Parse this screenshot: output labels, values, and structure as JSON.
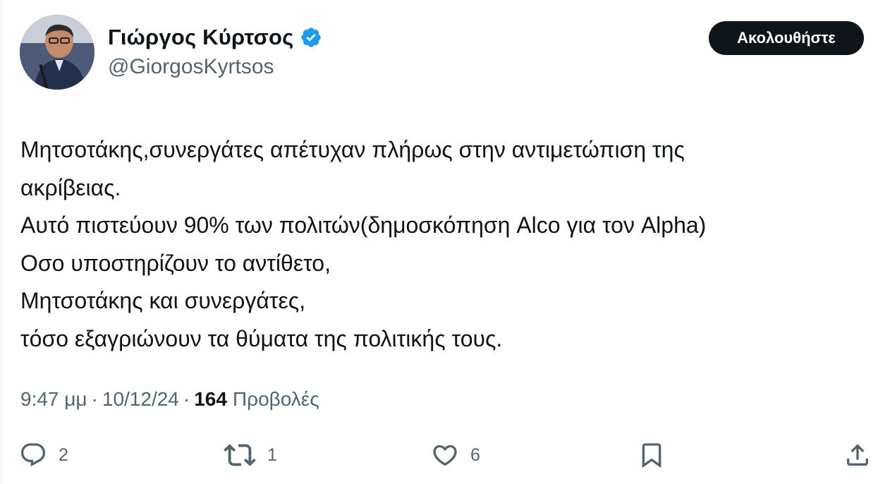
{
  "author": {
    "display_name": "Γιώργος Κύρτσος",
    "handle": "@GiorgosKyrtsos",
    "verified": true,
    "avatar_icon": "profile-photo"
  },
  "follow_button": {
    "label": "Ακολουθήστε"
  },
  "tweet": {
    "lines": [
      "Μητσοτάκης,συνεργάτες απέτυχαν πλήρως στην αντιμετώπιση της",
      "ακρίβειας.",
      "Αυτό πιστεύουν 90% των πολιτών(δημοσκόπηση Alco για τον Alpha)",
      "Οσο υποστηρίζουν το αντίθετο,",
      "Μητσοτάκης και συνεργάτες,",
      "τόσο εξαγριώνουν τα θύματα της πολιτικής τους."
    ]
  },
  "meta": {
    "time": "9:47 μμ",
    "separator": "·",
    "date": "10/12/24",
    "views_count": "164",
    "views_label": "Προβολές"
  },
  "actions": {
    "reply": {
      "icon": "reply-icon",
      "count": "2"
    },
    "retweet": {
      "icon": "retweet-icon",
      "count": "1"
    },
    "like": {
      "icon": "heart-icon",
      "count": "6"
    },
    "bookmark": {
      "icon": "bookmark-icon"
    },
    "share": {
      "icon": "share-icon"
    }
  },
  "colors": {
    "text_primary": "#0f1419",
    "text_secondary": "#536471",
    "verified_blue": "#1d9bf0",
    "follow_bg": "#0f1419",
    "follow_text": "#ffffff"
  }
}
